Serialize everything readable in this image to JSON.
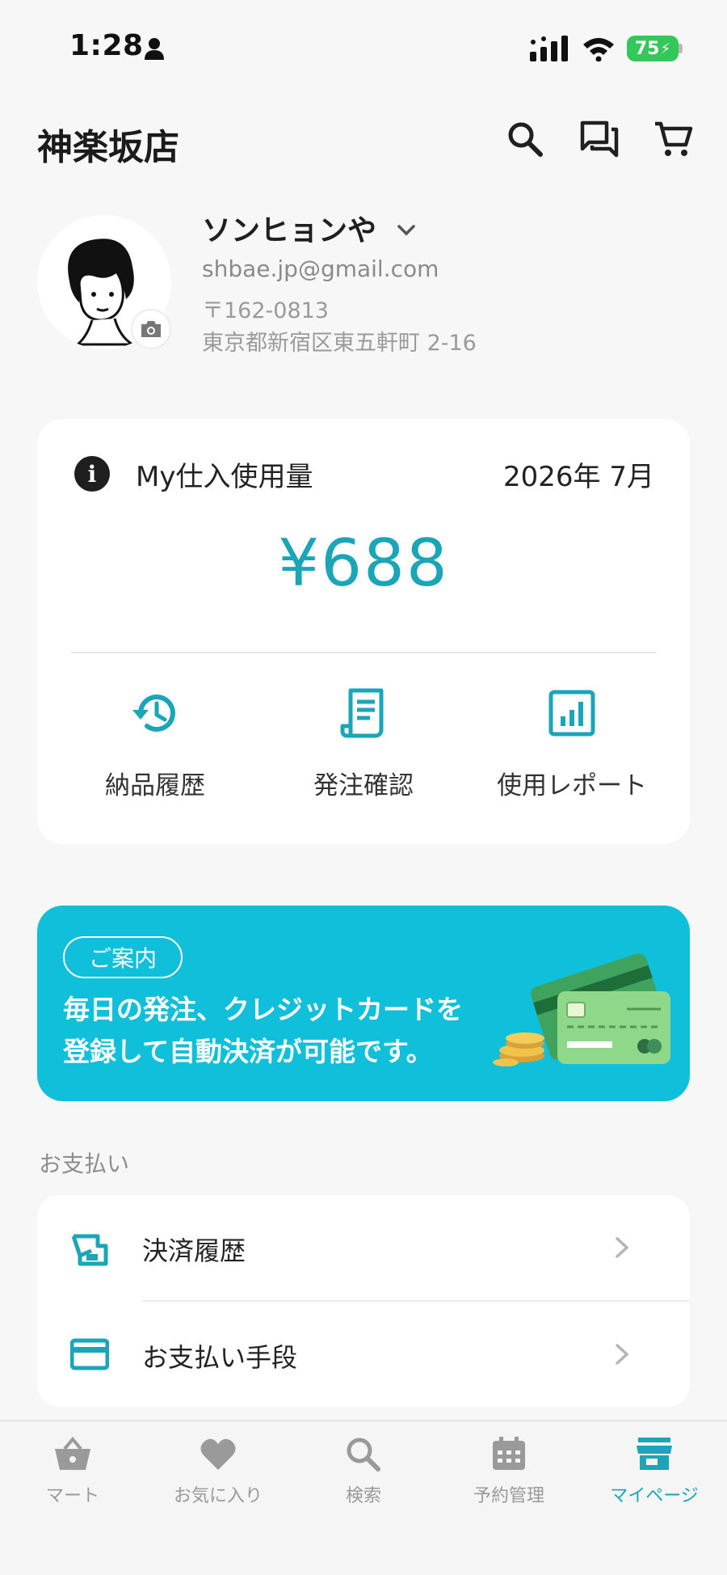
{
  "status_bar": {
    "time": "1:28",
    "battery": "75"
  },
  "header": {
    "title": "神楽坂店"
  },
  "profile": {
    "name": "ソンヒョンや",
    "email": "shbae.jp@gmail.com",
    "zip": "〒162-0813",
    "address": "東京都新宿区東五軒町 2-16"
  },
  "usage": {
    "label": "My仕入使用量",
    "month": "2026年 7月",
    "amount": "¥688",
    "actions": [
      {
        "label": "納品履歴",
        "icon": "history-icon"
      },
      {
        "label": "発注確認",
        "icon": "receipt-icon"
      },
      {
        "label": "使用レポート",
        "icon": "report-icon"
      }
    ]
  },
  "banner": {
    "badge": "ご案内",
    "line1": "毎日の発注、クレジットカードを",
    "line2": "登録して自動決済が可能です。"
  },
  "payment": {
    "section_label": "お支払い",
    "rows": [
      {
        "label": "決済履歴",
        "icon": "payment-history-icon"
      },
      {
        "label": "お支払い手段",
        "icon": "credit-card-icon"
      }
    ]
  },
  "nav": {
    "items": [
      {
        "label": "マート",
        "icon": "basket-icon"
      },
      {
        "label": "お気に入り",
        "icon": "heart-icon"
      },
      {
        "label": "検索",
        "icon": "search-icon"
      },
      {
        "label": "予約管理",
        "icon": "calendar-icon"
      },
      {
        "label": "マイページ",
        "icon": "store-icon"
      }
    ],
    "active_index": 4
  },
  "colors": {
    "accent": "#1aa5b8",
    "banner": "#10bfd9",
    "background": "#f7f7f7"
  }
}
